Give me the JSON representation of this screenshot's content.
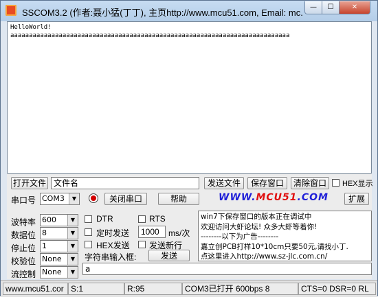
{
  "window": {
    "title": "SSCOM3.2 (作者:聂小猛(丁丁), 主页http://www.mcu51.com,  Email: mc...",
    "minimize": "—",
    "maximize": "☐",
    "close": "✕"
  },
  "receive": {
    "lines": [
      "HelloWorld!",
      "aaaaaaaaaaaaaaaaaaaaaaaaaaaaaaaaaaaaaaaaaaaaaaaaaaaaaaaaaaaaaaaaaaaaaaaaaaa"
    ]
  },
  "toolbar": {
    "open_file": "打开文件",
    "file_name_value": "文件名",
    "send_file": "发送文件",
    "save_window": "保存窗口",
    "clear_window": "清除窗口",
    "hex_display": "HEX显示"
  },
  "port": {
    "label": "串口号",
    "value": "COM3",
    "close_port": "关闭串口",
    "help": "帮助",
    "url_blue_1": "WWW.",
    "url_red": "MCU51",
    "url_blue_2": ".COM",
    "expand": "扩展"
  },
  "settings": {
    "baud_label": "波特率",
    "baud_value": "600",
    "databits_label": "数据位",
    "databits_value": "8",
    "stopbits_label": "停止位",
    "stopbits_value": "1",
    "parity_label": "校验位",
    "parity_value": "None",
    "flow_label": "流控制",
    "flow_value": "None"
  },
  "options": {
    "dtr": "DTR",
    "rts": "RTS",
    "timed_send": "定时发送",
    "interval_value": "1000",
    "interval_unit": "ms/次",
    "hex_send": "HEX发送",
    "send_newline": "发送新行",
    "string_input_label": "字符串输入框:",
    "send_button": "发送"
  },
  "ad": {
    "lines": [
      "win7下保存窗口的版本正在调试中",
      "欢迎访问大虾论坛! 众多大虾等着你!",
      "--------以下为广告--------",
      "嘉立创PCB打样10*10cm只要50元,请找小丁.",
      "点这里进入http://www.sz-jlc.com.cn/"
    ]
  },
  "send_input": {
    "value": "a"
  },
  "status": {
    "website": "www.mcu51.cor",
    "sent": "S:1",
    "received": "R:95",
    "port_status": "COM3已打开  600bps  8",
    "signals": "CTS=0 DSR=0 RL"
  }
}
